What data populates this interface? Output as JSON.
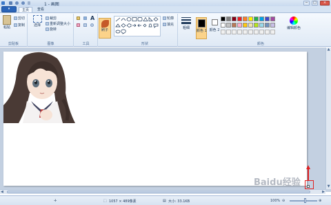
{
  "window": {
    "title": "1 - 画图",
    "minimize": "─",
    "maximize": "□",
    "close": "×"
  },
  "tabs": [
    {
      "label": "主页"
    },
    {
      "label": "查看"
    }
  ],
  "ribbon": {
    "clipboard": {
      "paste": "粘贴",
      "cut": "剪切",
      "copy": "复制",
      "label": "剪贴板"
    },
    "image": {
      "select": "选择",
      "crop": "裁剪",
      "resize": "重新调整大小",
      "rotate": "旋转",
      "label": "图像"
    },
    "tools": {
      "label": "工具",
      "text": "A"
    },
    "brushes": {
      "label": "刷子"
    },
    "shapes": {
      "outline": "轮廓",
      "fill": "填充",
      "label": "形状"
    },
    "size": {
      "label": "粗细"
    },
    "color1": {
      "label": "颜色 1"
    },
    "color2": {
      "label": "颜色 2"
    },
    "edit_colors": {
      "label": "编辑颜色"
    },
    "colors_label": "颜色",
    "palette": [
      "#000000",
      "#7f7f7f",
      "#880015",
      "#ed1c24",
      "#ff7f27",
      "#fff200",
      "#22b14c",
      "#00a2e8",
      "#3f48cc",
      "#a349a4",
      "#ffffff",
      "#c3c3c3",
      "#b97a57",
      "#ffaec9",
      "#ffc90e",
      "#efe4b0",
      "#b5e61d",
      "#99d9ea",
      "#7092be",
      "#c8bfe7"
    ]
  },
  "status": {
    "dimensions": "1057 × 489像素",
    "size": "大小: 33.1KB",
    "zoom": "100%"
  },
  "watermark": "Baidu经验"
}
